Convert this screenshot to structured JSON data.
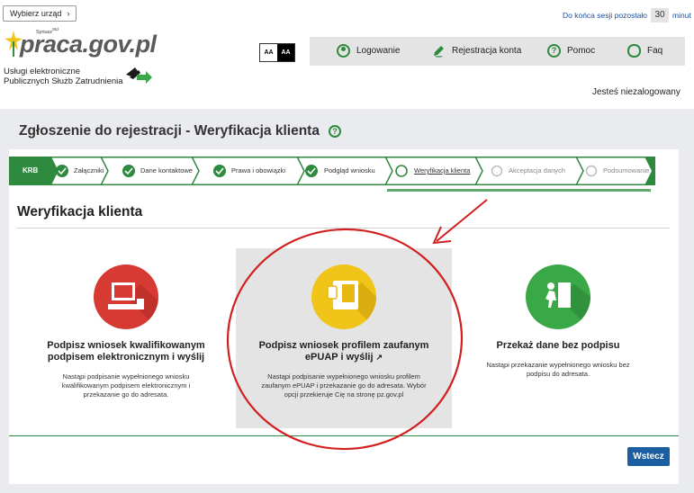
{
  "header": {
    "select_office": "Wybierz urząd",
    "session_prefix": "Do końca sesji pozostało",
    "session_minutes": "30",
    "session_suffix": "minut",
    "logo_tag": "Syriusz",
    "logo_tag_sup": "Std",
    "logo_text": "praca.gov.pl",
    "subtitle_line1": "Usługi elektroniczne",
    "subtitle_line2": "Publicznych Służb Zatrudnienia",
    "font_small": "AA",
    "font_large": "AA",
    "not_logged": "Jesteś niezalogowany"
  },
  "nav": {
    "items": [
      {
        "label": "Logowanie",
        "icon": "user-icon"
      },
      {
        "label": "Rejestracja konta",
        "icon": "pencil-icon"
      },
      {
        "label": "Pomoc",
        "icon": "help-icon"
      },
      {
        "label": "Faq",
        "icon": "chat-icon"
      }
    ]
  },
  "page": {
    "title": "Zgłoszenie do rejestracji - Weryfikacja klienta",
    "section_title": "Weryfikacja klienta"
  },
  "steps": [
    {
      "label": "KRB",
      "state": "first"
    },
    {
      "label": "Załączniki",
      "state": "done"
    },
    {
      "label": "Dane kontaktowe",
      "state": "done"
    },
    {
      "label": "Prawa i obowiązki",
      "state": "done"
    },
    {
      "label": "Podgląd wniosku",
      "state": "done"
    },
    {
      "label": "Weryfikacja klienta",
      "state": "active"
    },
    {
      "label": "Akceptacja danych",
      "state": "todo"
    },
    {
      "label": "Podsumowanie",
      "state": "todo"
    }
  ],
  "options": [
    {
      "title": "Podpisz wniosek kwalifikowanym podpisem elektronicznym i wyślij",
      "desc": "Nastąpi podpisanie wypełnionego wniosku kwalifikowanym podpisem elektronicznym i przekazanie go do adresata.",
      "icon": "computer-icon",
      "color": "#d63a33"
    },
    {
      "title": "Podpisz wniosek profilem zaufanym ePUAP i wyślij",
      "desc": "Nastąpi podpisanie wypełnionego wniosku profilem zaufanym ePUAP i przekazanie go do adresata. Wybór opcji przekieruje Cię na stronę pz.gov.pl",
      "icon": "card-reader-icon",
      "color": "#f0c419"
    },
    {
      "title": "Przekaż dane bez podpisu",
      "desc": "Nastąpi przekazanie wypełnionego wniosku bez podpisu do adresata.",
      "icon": "walk-in-icon",
      "color": "#3aa847"
    }
  ],
  "actions": {
    "back": "Wstecz"
  },
  "colors": {
    "brand_green": "#2d8a3e",
    "button_blue": "#1c5fa0",
    "annotation_red": "#d11f1f"
  }
}
